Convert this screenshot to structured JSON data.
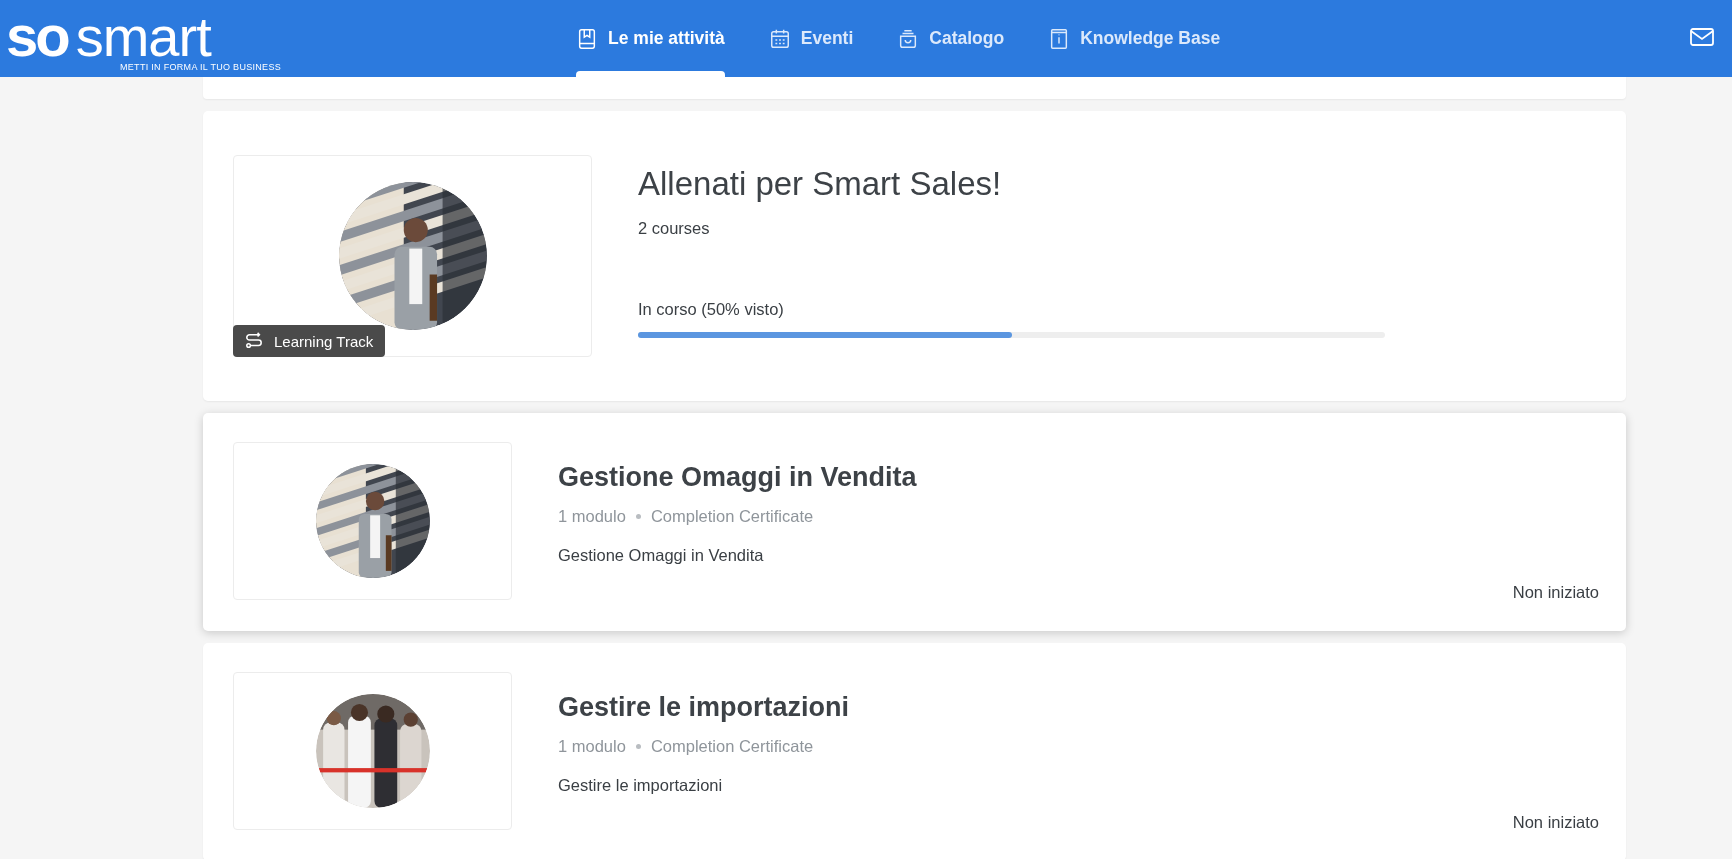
{
  "header": {
    "logo": {
      "mark": "so",
      "word": "smart",
      "tagline": "METTI IN FORMA IL TUO BUSINESS"
    },
    "tabs": [
      {
        "label": "Le mie attività",
        "selected": true
      },
      {
        "label": "Eventi",
        "selected": false
      },
      {
        "label": "Catalogo",
        "selected": false
      },
      {
        "label": "Knowledge Base",
        "selected": false
      }
    ]
  },
  "cards": [
    {
      "kind": "track",
      "title": "Allenati per Smart Sales!",
      "subtitle": "2 courses",
      "badge": "Learning Track",
      "status": "In corso (50% visto)",
      "level": 0.5,
      "hovered": false
    },
    {
      "kind": "course",
      "title": "Gestione Omaggi in Vendita",
      "meta": [
        "1 modulo",
        "Completion Certificate"
      ],
      "description": "Gestione Omaggi in Vendita",
      "status": "Non iniziato",
      "hovered": true
    },
    {
      "kind": "course",
      "title": "Gestire le importazioni",
      "meta": [
        "1 modulo",
        "Completion Certificate"
      ],
      "description": "Gestire le importazioni",
      "status": "Non iniziato",
      "hovered": false
    }
  ]
}
